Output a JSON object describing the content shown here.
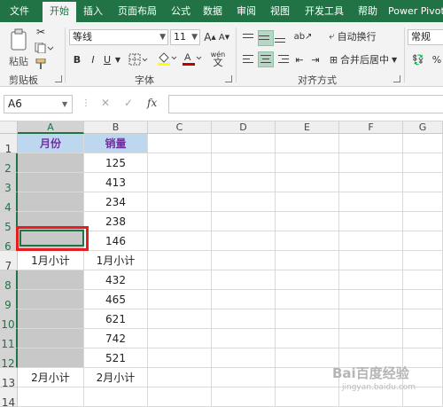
{
  "tabs": [
    {
      "label": "文件",
      "active": false
    },
    {
      "label": "开始",
      "active": true
    },
    {
      "label": "插入",
      "active": false
    },
    {
      "label": "页面布局",
      "active": false
    },
    {
      "label": "公式",
      "active": false
    },
    {
      "label": "数据",
      "active": false
    },
    {
      "label": "审阅",
      "active": false
    },
    {
      "label": "视图",
      "active": false
    },
    {
      "label": "开发工具",
      "active": false
    },
    {
      "label": "帮助",
      "active": false
    },
    {
      "label": "Power Pivot",
      "active": false
    }
  ],
  "ribbon": {
    "clipboard": {
      "paste_label": "粘贴",
      "group_label": "剪贴板"
    },
    "font": {
      "font_name": "等线",
      "font_size": "11",
      "bold": "B",
      "italic": "I",
      "underline": "U",
      "grow": "A",
      "shrink": "A",
      "font_color_letter": "A",
      "wen": "wén",
      "group_label": "字体"
    },
    "alignment": {
      "wrap_text": "自动换行",
      "merge_center": "合并后居中",
      "group_label": "对齐方式"
    },
    "number": {
      "format": "常规",
      "percent": "%"
    }
  },
  "formula_bar": {
    "name_box": "A6",
    "cancel": "✕",
    "enter": "✓",
    "fx": "fx",
    "formula": ""
  },
  "sheet": {
    "columns": [
      "A",
      "B",
      "C",
      "D",
      "E",
      "F",
      "G"
    ],
    "rows": [
      "1",
      "2",
      "3",
      "4",
      "5",
      "6",
      "7",
      "8",
      "9",
      "10",
      "11",
      "12",
      "13",
      "14"
    ],
    "header": {
      "a": "月份",
      "b": "销量"
    },
    "values_b": [
      "125",
      "413",
      "234",
      "238",
      "146",
      "1月小计",
      "432",
      "465",
      "621",
      "742",
      "521",
      "2月小计"
    ],
    "values_a": [
      "",
      "",
      "",
      "",
      "",
      "1月小计",
      "",
      "",
      "",
      "",
      "",
      "2月小计"
    ]
  },
  "watermark": {
    "text": "Bai百度经验",
    "sub": "jingyan.baidu.com"
  },
  "colors": {
    "excel_green": "#217346",
    "header_fill": "#bdd7ee",
    "header_text": "#7030a0",
    "blank_fill": "#c8c8c8",
    "highlight": "#e02020"
  }
}
